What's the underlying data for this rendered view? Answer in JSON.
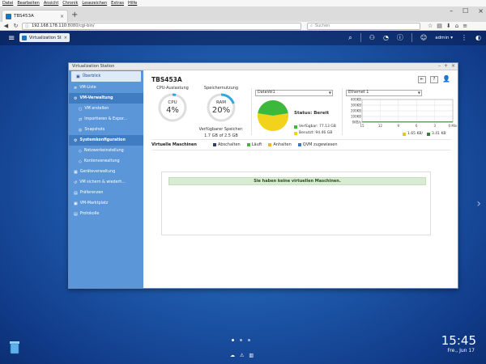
{
  "browser": {
    "menu": [
      "Datei",
      "Bearbeiten",
      "Ansicht",
      "Chronik",
      "Lesezeichen",
      "Extras",
      "Hilfe"
    ],
    "tab_title": "TBS453A",
    "url_host": "192.168.178.110",
    "url_rest": ":8080/cgi-bin/",
    "search_placeholder": "Suchen"
  },
  "qts": {
    "app_tab": "Virtualization St...",
    "user": "admin ▾",
    "clock": "15:45",
    "date": "Fre., Jun 17"
  },
  "window": {
    "title": "Virtualization Station",
    "main_title": "TBS453A",
    "sidebar": [
      {
        "label": "Überblick",
        "kind": "sel"
      },
      {
        "label": "VM-Liste",
        "kind": "item"
      },
      {
        "label": "VM-Verwaltung",
        "kind": "headsel"
      },
      {
        "label": "VM erstellen",
        "kind": "sub"
      },
      {
        "label": "Importieren & Expor...",
        "kind": "sub"
      },
      {
        "label": "Snapshots",
        "kind": "sub"
      },
      {
        "label": "Systemkonfiguration",
        "kind": "headsel"
      },
      {
        "label": "Netzwerkeinstellung",
        "kind": "sub"
      },
      {
        "label": "Kontenverwaltung",
        "kind": "sub"
      },
      {
        "label": "Geräteverwaltung",
        "kind": "item"
      },
      {
        "label": "VM sichern & wiederh...",
        "kind": "item"
      },
      {
        "label": "Präferenzen",
        "kind": "item"
      },
      {
        "label": "VM-Marktplatz",
        "kind": "item"
      },
      {
        "label": "Protokolle",
        "kind": "item"
      }
    ],
    "cpu": {
      "label": "CPU-Auslastung",
      "name": "CPU",
      "value": "4%",
      "fraction": 0.04
    },
    "ram": {
      "label": "Speichernutzung",
      "name": "RAM",
      "value": "20%",
      "fraction": 0.2,
      "avail_label": "Verfügbarer Speicher:",
      "avail_value": "1.7 GB of 2.5 GB"
    },
    "storage": {
      "volume": "DataVol1",
      "status": "Status: Bereit",
      "free_label": "Verfügbar: 77.13 GB",
      "used_label": "Benutzt: 94.46 GB",
      "free_gb": 77.13,
      "used_gb": 94.46,
      "free_color": "#3cb83c",
      "used_color": "#f2d21a"
    },
    "network": {
      "adapter": "Ethernet 1",
      "rx": "1.65 KB/",
      "tx": "3.41 KB"
    },
    "vm_section": {
      "title": "Virtuelle Maschinen",
      "actions": [
        {
          "label": "Abschalten",
          "color": "#2d3f6a"
        },
        {
          "label": "Läuft",
          "color": "#3cb83c"
        },
        {
          "label": "Anhalten",
          "color": "#f0b820"
        },
        {
          "label": "QVM zugewiesen",
          "color": "#3a78c8"
        }
      ],
      "empty_msg": "Sie haben keine virtuellen Maschinen."
    }
  },
  "chart_data": {
    "type": "line",
    "title": "",
    "xlabel": "",
    "ylabel": "",
    "categories": [
      "15",
      "12",
      "9",
      "6",
      "3",
      "0 Min"
    ],
    "yticks": [
      "400KB",
      "300KB",
      "200KB",
      "100KB",
      "0KB/s"
    ],
    "ylim": [
      0,
      400
    ],
    "grid": true,
    "series": [
      {
        "values": [
          1.65,
          1.65,
          1.65,
          1.65,
          1.65,
          1.65
        ],
        "color": "#f0c020"
      },
      {
        "values": [
          3.41,
          3.41,
          3.41,
          3.41,
          3.41,
          3.41
        ],
        "color": "#3a7a3a"
      }
    ]
  }
}
